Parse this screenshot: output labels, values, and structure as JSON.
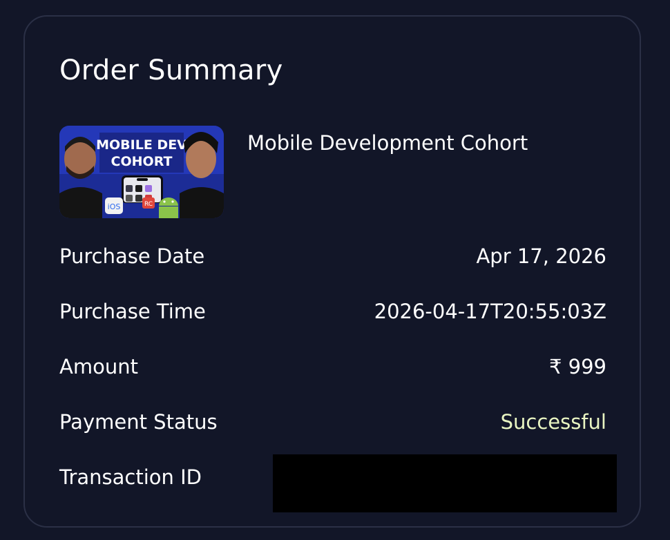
{
  "card": {
    "title": "Order Summary",
    "product": {
      "name": "Mobile Development Cohort",
      "thumbnail": {
        "headline_line1": "MOBILE DEV",
        "headline_line2": "COHORT",
        "badge_ios": "iOS",
        "badge_rc": "RC"
      }
    },
    "rows": [
      {
        "label": "Purchase Date",
        "value": "Apr 17, 2026"
      },
      {
        "label": "Purchase Time",
        "value": "2026-04-17T20:55:03Z"
      },
      {
        "label": "Amount",
        "value": "₹ 999"
      },
      {
        "label": "Payment Status",
        "value": "Successful"
      },
      {
        "label": "Transaction ID",
        "value": ""
      }
    ]
  },
  "colors": {
    "background": "#121628",
    "card_border": "#2b3046",
    "text": "#ffffff",
    "status_success": "#e9f5c2",
    "redaction": "#000000"
  }
}
